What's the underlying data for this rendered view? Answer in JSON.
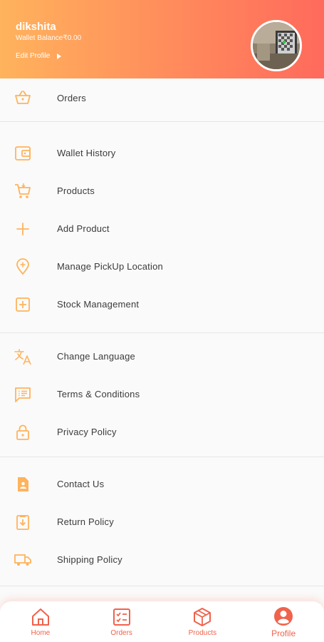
{
  "header": {
    "user_name": "dikshita",
    "wallet_balance": "Wallet Balance₹0.00",
    "edit_profile": "Edit Profile"
  },
  "menu": {
    "orders": "Orders",
    "wallet_history": "Wallet History",
    "products": "Products",
    "add_product": "Add Product",
    "manage_pickup": "Manage PickUp Location",
    "stock_management": "Stock Management",
    "change_language": "Change Language",
    "terms": "Terms & Conditions",
    "privacy": "Privacy Policy",
    "contact": "Contact Us",
    "return_policy": "Return Policy",
    "shipping_policy": "Shipping Policy"
  },
  "bottom_nav": {
    "home": "Home",
    "orders": "Orders",
    "products": "Products",
    "profile": "Profile"
  },
  "colors": {
    "accent": "#ffb35c",
    "brand": "#f0624b"
  }
}
